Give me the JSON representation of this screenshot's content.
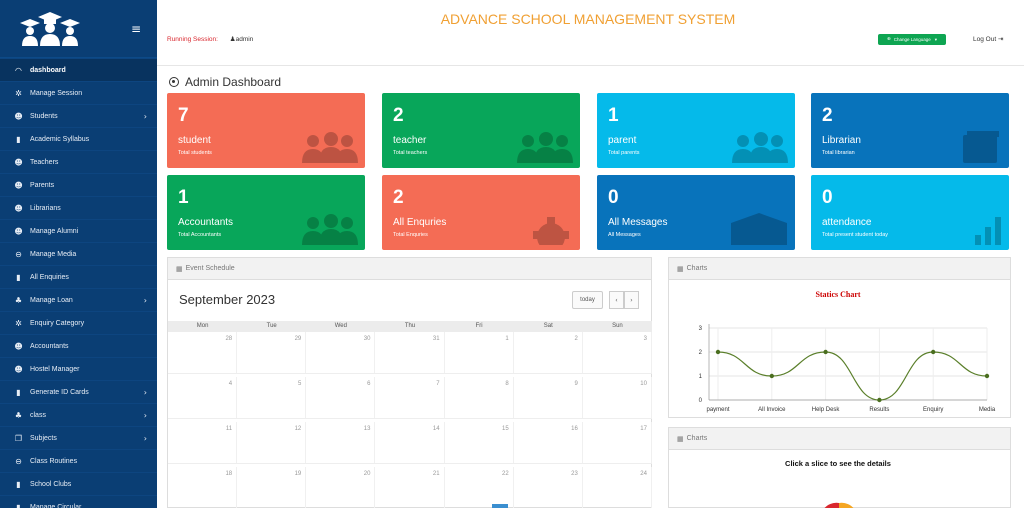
{
  "header": {
    "title": "ADVANCE SCHOOL MANAGEMENT SYSTEM",
    "session_label": "Running Session:",
    "session_user": "admin",
    "change_language": "Change Language",
    "logout": "Log Out"
  },
  "sidebar": {
    "items": [
      {
        "label": "dashboard",
        "icon": "dashboard-icon",
        "glyph": "◠"
      },
      {
        "label": "Manage Session",
        "icon": "gear-icon",
        "glyph": "✲"
      },
      {
        "label": "Students",
        "icon": "users-icon",
        "glyph": "☻"
      },
      {
        "label": "Academic Syllabus",
        "icon": "book-icon",
        "glyph": "▮"
      },
      {
        "label": "Teachers",
        "icon": "users-icon",
        "glyph": "☻"
      },
      {
        "label": "Parents",
        "icon": "users-icon",
        "glyph": "☻"
      },
      {
        "label": "Librarians",
        "icon": "users-icon",
        "glyph": "☻"
      },
      {
        "label": "Manage Alumni",
        "icon": "users-icon",
        "glyph": "☻"
      },
      {
        "label": "Manage Media",
        "icon": "media-icon",
        "glyph": "⊖"
      },
      {
        "label": "All Enquiries",
        "icon": "book-icon",
        "glyph": "▮"
      },
      {
        "label": "Manage Loan",
        "icon": "sitemap-icon",
        "glyph": "♣"
      },
      {
        "label": "Enquiry Category",
        "icon": "gear-icon",
        "glyph": "✲"
      },
      {
        "label": "Accountants",
        "icon": "users-icon",
        "glyph": "☻"
      },
      {
        "label": "Hostel Manager",
        "icon": "users-icon",
        "glyph": "☻"
      },
      {
        "label": "Generate ID Cards",
        "icon": "book-icon",
        "glyph": "▮"
      },
      {
        "label": "class",
        "icon": "sitemap-icon",
        "glyph": "♣"
      },
      {
        "label": "Subjects",
        "icon": "subjects-icon",
        "glyph": "❐"
      },
      {
        "label": "Class Routines",
        "icon": "routine-icon",
        "glyph": "⊖"
      },
      {
        "label": "School Clubs",
        "icon": "book-icon",
        "glyph": "▮"
      },
      {
        "label": "Manage Circular",
        "icon": "book-icon",
        "glyph": "▮"
      }
    ]
  },
  "page": {
    "title": "Admin Dashboard"
  },
  "cards": [
    {
      "value": "7",
      "label": "student",
      "sub": "Total students",
      "color": "#f46c55"
    },
    {
      "value": "2",
      "label": "teacher",
      "sub": "Total teachers",
      "color": "#08a65a"
    },
    {
      "value": "1",
      "label": "parent",
      "sub": "Total parents",
      "color": "#05baea"
    },
    {
      "value": "2",
      "label": "Librarian",
      "sub": "Total librarian",
      "color": "#0873bb"
    },
    {
      "value": "1",
      "label": "Accountants",
      "sub": "Total Accountants",
      "color": "#08a65a"
    },
    {
      "value": "2",
      "label": "All Enquries",
      "sub": "Total Enquries",
      "color": "#f46c55"
    },
    {
      "value": "0",
      "label": "All Messages",
      "sub": "All Messages",
      "color": "#0873bb"
    },
    {
      "value": "0",
      "label": "attendance",
      "sub": "Total present student today",
      "color": "#05baea"
    }
  ],
  "calendar": {
    "panel_title": "Event Schedule",
    "month": "September 2023",
    "today": "today",
    "prev": "‹",
    "next": "›",
    "days": [
      "Mon",
      "Tue",
      "Wed",
      "Thu",
      "Fri",
      "Sat",
      "Sun"
    ],
    "weeks": [
      [
        "28",
        "29",
        "30",
        "31",
        "1",
        "2",
        "3"
      ],
      [
        "4",
        "5",
        "6",
        "7",
        "8",
        "9",
        "10"
      ],
      [
        "11",
        "12",
        "13",
        "14",
        "15",
        "16",
        "17"
      ],
      [
        "18",
        "19",
        "20",
        "21",
        "22",
        "23",
        "24"
      ]
    ]
  },
  "charts_panel": {
    "title": "Charts",
    "chart_title": "Statics Chart"
  },
  "pie_panel": {
    "title": "Charts",
    "subtitle": "Click a slice to see the details"
  },
  "chart_data": {
    "type": "line",
    "title": "Statics Chart",
    "categories": [
      "payment",
      "All Invoice",
      "Help Desk",
      "Results",
      "Enquiry",
      "Media"
    ],
    "values": [
      2,
      1,
      2,
      0,
      2,
      1
    ],
    "ylim": [
      0,
      3
    ],
    "yticks": [
      "0",
      "1",
      "2",
      "3"
    ],
    "grid": true,
    "line_color": "#5a7f2a"
  }
}
